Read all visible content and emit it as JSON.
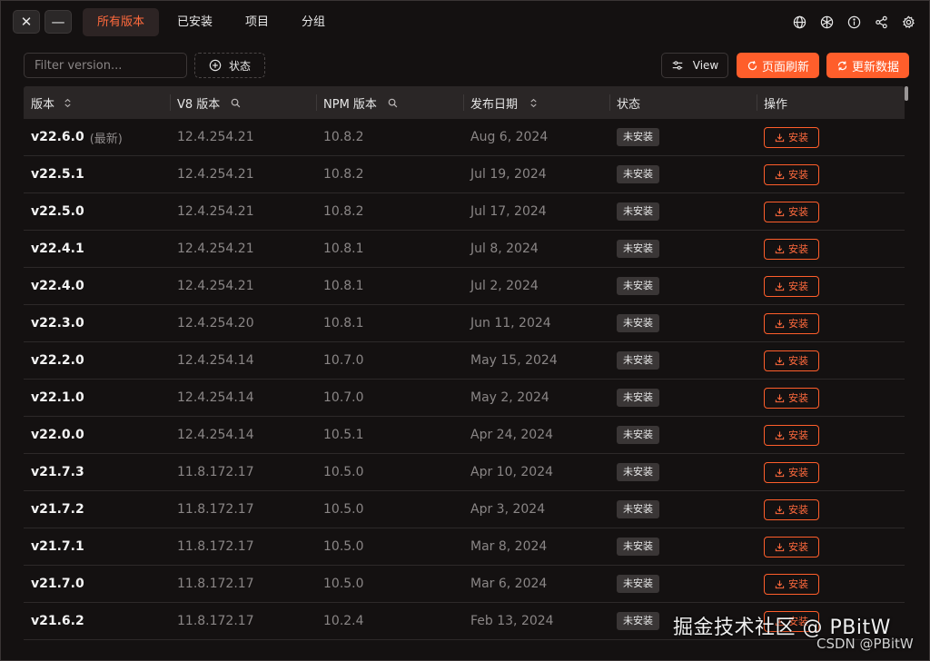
{
  "titlebar": {
    "close_label": "✕",
    "minimize_label": "—",
    "tabs": [
      {
        "label": "所有版本",
        "active": true
      },
      {
        "label": "已安装",
        "active": false
      },
      {
        "label": "项目",
        "active": false
      },
      {
        "label": "分组",
        "active": false
      }
    ],
    "icons": [
      "globe-icon",
      "aperture-icon",
      "info-icon",
      "share-icon",
      "gear-icon"
    ]
  },
  "toolbar": {
    "filter_placeholder": "Filter version...",
    "filter_value": "",
    "status_label": "状态",
    "view_label": "View",
    "refresh_page_label": "页面刷新",
    "update_data_label": "更新数据"
  },
  "table": {
    "headers": {
      "version": "版本",
      "v8": "V8 版本",
      "npm": "NPM 版本",
      "date": "发布日期",
      "status": "状态",
      "action": "操作"
    },
    "latest_tag": "(最新)",
    "rows": [
      {
        "version": "v22.6.0",
        "latest": true,
        "v8": "12.4.254.21",
        "npm": "10.8.2",
        "date": "Aug 6, 2024",
        "status": "未安装",
        "action": "安装"
      },
      {
        "version": "v22.5.1",
        "latest": false,
        "v8": "12.4.254.21",
        "npm": "10.8.2",
        "date": "Jul 19, 2024",
        "status": "未安装",
        "action": "安装"
      },
      {
        "version": "v22.5.0",
        "latest": false,
        "v8": "12.4.254.21",
        "npm": "10.8.2",
        "date": "Jul 17, 2024",
        "status": "未安装",
        "action": "安装"
      },
      {
        "version": "v22.4.1",
        "latest": false,
        "v8": "12.4.254.21",
        "npm": "10.8.1",
        "date": "Jul 8, 2024",
        "status": "未安装",
        "action": "安装"
      },
      {
        "version": "v22.4.0",
        "latest": false,
        "v8": "12.4.254.21",
        "npm": "10.8.1",
        "date": "Jul 2, 2024",
        "status": "未安装",
        "action": "安装"
      },
      {
        "version": "v22.3.0",
        "latest": false,
        "v8": "12.4.254.20",
        "npm": "10.8.1",
        "date": "Jun 11, 2024",
        "status": "未安装",
        "action": "安装"
      },
      {
        "version": "v22.2.0",
        "latest": false,
        "v8": "12.4.254.14",
        "npm": "10.7.0",
        "date": "May 15, 2024",
        "status": "未安装",
        "action": "安装"
      },
      {
        "version": "v22.1.0",
        "latest": false,
        "v8": "12.4.254.14",
        "npm": "10.7.0",
        "date": "May 2, 2024",
        "status": "未安装",
        "action": "安装"
      },
      {
        "version": "v22.0.0",
        "latest": false,
        "v8": "12.4.254.14",
        "npm": "10.5.1",
        "date": "Apr 24, 2024",
        "status": "未安装",
        "action": "安装"
      },
      {
        "version": "v21.7.3",
        "latest": false,
        "v8": "11.8.172.17",
        "npm": "10.5.0",
        "date": "Apr 10, 2024",
        "status": "未安装",
        "action": "安装"
      },
      {
        "version": "v21.7.2",
        "latest": false,
        "v8": "11.8.172.17",
        "npm": "10.5.0",
        "date": "Apr 3, 2024",
        "status": "未安装",
        "action": "安装"
      },
      {
        "version": "v21.7.1",
        "latest": false,
        "v8": "11.8.172.17",
        "npm": "10.5.0",
        "date": "Mar 8, 2024",
        "status": "未安装",
        "action": "安装"
      },
      {
        "version": "v21.7.0",
        "latest": false,
        "v8": "11.8.172.17",
        "npm": "10.5.0",
        "date": "Mar 6, 2024",
        "status": "未安装",
        "action": "安装"
      },
      {
        "version": "v21.6.2",
        "latest": false,
        "v8": "11.8.172.17",
        "npm": "10.2.4",
        "date": "Feb 13, 2024",
        "status": "未安装",
        "action": "安装"
      }
    ]
  },
  "watermark": {
    "primary": "掘金技术社区 @ PBitW",
    "secondary": "CSDN @PBitW"
  },
  "colors": {
    "accent": "#ff5e2b",
    "background": "#141111",
    "header": "#2a2626"
  }
}
